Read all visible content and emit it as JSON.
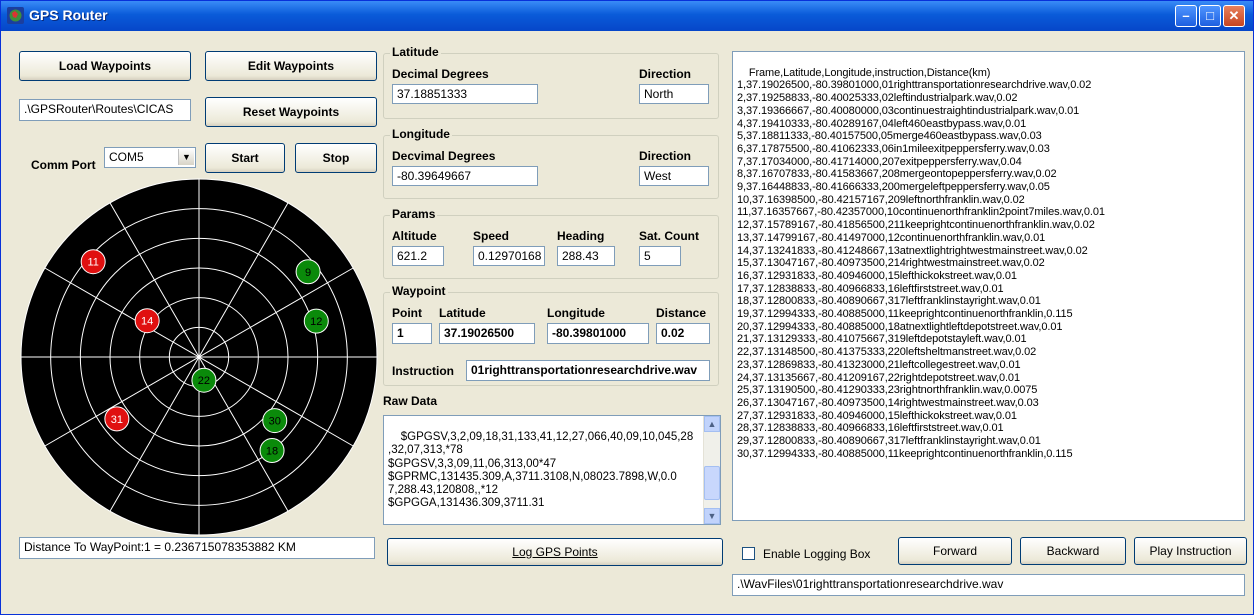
{
  "window": {
    "title": "GPS Router"
  },
  "left": {
    "load_waypoints": "Load Waypoints",
    "edit_waypoints": "Edit Waypoints",
    "route_path": ".\\GPSRouter\\Routes\\CICAS",
    "reset_waypoints": "Reset Waypoints",
    "comm_port_label": "Comm Port",
    "comm_port_value": "COM5",
    "start": "Start",
    "stop": "Stop",
    "distance_readout": "Distance To WayPoint:1 = 0.236715078353882 KM"
  },
  "radar": {
    "satellites": [
      {
        "id": "11",
        "status": "red",
        "az": 312,
        "el": 18
      },
      {
        "id": "9",
        "status": "green",
        "az": 52,
        "el": 20
      },
      {
        "id": "14",
        "status": "red",
        "az": 305,
        "el": 58
      },
      {
        "id": "12",
        "status": "green",
        "az": 73,
        "el": 28
      },
      {
        "id": "22",
        "status": "green",
        "az": 168,
        "el": 78
      },
      {
        "id": "30",
        "status": "green",
        "az": 130,
        "el": 40
      },
      {
        "id": "18",
        "status": "green",
        "az": 142,
        "el": 30
      },
      {
        "id": "31",
        "status": "red",
        "az": 233,
        "el": 38
      }
    ],
    "colors": {
      "red": "#e01010",
      "green": "#0a8a0a",
      "grid": "#ffffff",
      "bg": "#000000"
    }
  },
  "latitude": {
    "group": "Latitude",
    "decimal_label": "Decimal Degrees",
    "decimal_value": "37.18851333",
    "direction_label": "Direction",
    "direction_value": "North"
  },
  "longitude": {
    "group": "Longitude",
    "decimal_label": "Decvimal Degrees",
    "decimal_value": "-80.39649667",
    "direction_label": "Direction",
    "direction_value": "West"
  },
  "params": {
    "group": "Params",
    "altitude_label": "Altitude",
    "altitude_value": "621.2",
    "speed_label": "Speed",
    "speed_value": "0.12970168",
    "heading_label": "Heading",
    "heading_value": "288.43",
    "sat_label": "Sat. Count",
    "sat_value": "5"
  },
  "waypoint": {
    "group": "Waypoint",
    "point_label": "Point",
    "point_value": "1",
    "lat_label": "Latitude",
    "lat_value": "37.19026500",
    "lon_label": "Longitude",
    "lon_value": "-80.39801000",
    "dist_label": "Distance",
    "dist_value": "0.02",
    "instruction_label": "Instruction",
    "instruction_value": "01righttransportationresearchdrive.wav"
  },
  "raw": {
    "label": "Raw Data",
    "text": "$GPGSV,3,2,09,18,31,133,41,12,27,066,40,09,10,045,28\n,32,07,313,*78\n$GPGSV,3,3,09,11,06,313,00*47\n$GPRMC,131435.309,A,3711.3108,N,08023.7898,W,0.0\n7,288.43,120808,,*12\n$GPGGA,131436.309,3711.31"
  },
  "log_gps": "Log GPS Points",
  "right": {
    "list_text": "Frame,Latitude,Longitude,instruction,Distance(km)\n1,37.19026500,-80.39801000,01righttransportationresearchdrive.wav,0.02\n2,37.19258833,-80.40025333,02leftindustrialpark.wav,0.02\n3,37.19366667,-80.40080000,03continuestraightindustrialpark.wav,0.01\n4,37.19410333,-80.40289167,04left460eastbypass.wav,0.01\n5,37.18811333,-80.40157500,05merge460eastbypass.wav,0.03\n6,37.17875500,-80.41062333,06in1mileexitpeppersferry.wav,0.03\n7,37.17034000,-80.41714000,207exitpeppersferry.wav,0.04\n8,37.16707833,-80.41583667,208mergeontopeppersferry.wav,0.02\n9,37.16448833,-80.41666333,200mergeleftpeppersferry.wav,0.05\n10,37.16398500,-80.42157167,209leftnorthfranklin.wav,0.02\n11,37.16357667,-80.42357000,10continuenorthfranklin2point7miles.wav,0.01\n12,37.15789167,-80.41856500,211keeprightcontinuenorthfranklin.wav,0.02\n13,37.14799167,-80.41497000,12continuenorthfranklin.wav,0.01\n14,37.13241833,-80.41248667,13atnextlightrightwestmainstreet.wav,0.02\n15,37.13047167,-80.40973500,214rightwestmainstreet.wav,0.02\n16,37.12931833,-80.40946000,15lefthickokstreet.wav,0.01\n17,37.12838833,-80.40966833,16leftfirststreet.wav,0.01\n18,37.12800833,-80.40890667,317leftfranklinstayright.wav,0.01\n19,37.12994333,-80.40885000,11keeprightcontinuenorthfranklin,0.115\n20,37.12994333,-80.40885000,18atnextlightleftdepotstreet.wav,0.01\n21,37.13129333,-80.41075667,319leftdepotstayleft.wav,0.01\n22,37.13148500,-80.41375333,220leftsheltmanstreet.wav,0.02\n23,37.12869833,-80.41323000,21leftcollegestreet.wav,0.01\n24,37.13135667,-80.41209167,22rightdepotstreet.wav,0.01\n25,37.13190500,-80.41290333,23rightnorthfranklin.wav,0.0075\n26,37.13047167,-80.40973500,14rightwestmainstreet.wav,0.03\n27,37.12931833,-80.40946000,15lefthickokstreet.wav,0.01\n28,37.12838833,-80.40966833,16leftfirststreet.wav,0.01\n29,37.12800833,-80.40890667,317leftfranklinstayright.wav,0.01\n30,37.12994333,-80.40885000,11keeprightcontinuenorthfranklin,0.115",
    "enable_logging": "Enable Logging Box",
    "forward": "Forward",
    "backward": "Backward",
    "play": "Play Instruction",
    "wav_path": ".\\WavFiles\\01righttransportationresearchdrive.wav"
  }
}
